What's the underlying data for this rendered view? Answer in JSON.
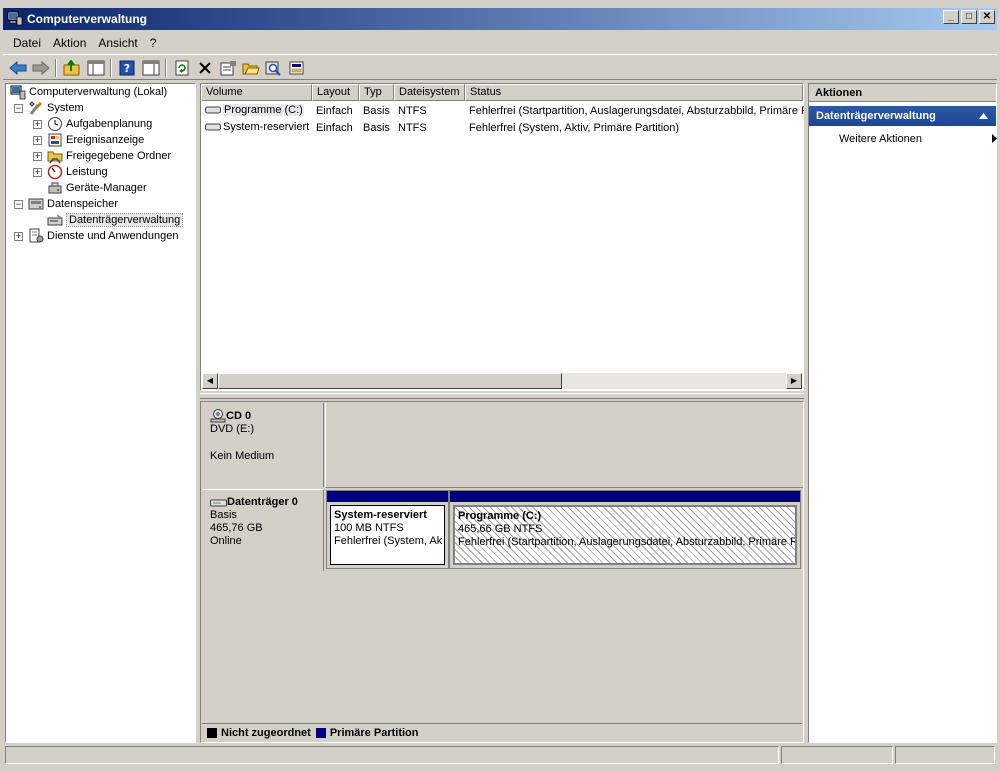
{
  "window": {
    "title": "Computerverwaltung"
  },
  "menu": [
    "Datei",
    "Aktion",
    "Ansicht",
    "?"
  ],
  "tree": {
    "root": "Computerverwaltung (Lokal)",
    "system": "System",
    "aufgabenplanung": "Aufgabenplanung",
    "ereignisanzeige": "Ereignisanzeige",
    "freigegebene_ordner": "Freigegebene Ordner",
    "leistung": "Leistung",
    "geraete_manager": "Geräte-Manager",
    "datenspeicher": "Datenspeicher",
    "datentraegerverwaltung": "Datenträgerverwaltung",
    "dienste": "Dienste und Anwendungen"
  },
  "volumes": {
    "headers": [
      "Volume",
      "Layout",
      "Typ",
      "Dateisystem",
      "Status"
    ],
    "rows": [
      {
        "volume": "Programme (C:)",
        "layout": "Einfach",
        "typ": "Basis",
        "fs": "NTFS",
        "status": "Fehlerfrei (Startpartition, Auslagerungsdatei, Absturzabbild, Primäre P"
      },
      {
        "volume": "System-reserviert",
        "layout": "Einfach",
        "typ": "Basis",
        "fs": "NTFS",
        "status": "Fehlerfrei (System, Aktiv, Primäre Partition)"
      }
    ]
  },
  "disks": {
    "cd": {
      "name": "CD 0",
      "type": "DVD (E:)",
      "media": "Kein Medium"
    },
    "disk0": {
      "name": "Datenträger 0",
      "kind": "Basis",
      "size": "465,76 GB",
      "state": "Online",
      "partitions": [
        {
          "name": "System-reserviert",
          "size": "100 MB NTFS",
          "status": "Fehlerfrei (System, Ak"
        },
        {
          "name": "Programme  (C:)",
          "size": "465,66 GB NTFS",
          "status": "Fehlerfrei (Startpartition, Auslagerungsdatei, Absturzabbild, Primäre P"
        }
      ]
    }
  },
  "legend": {
    "unallocated": "Nicht zugeordnet",
    "primary": "Primäre Partition",
    "unallocated_color": "#000000",
    "primary_color": "#000080"
  },
  "actions": {
    "title": "Aktionen",
    "section": "Datenträgerverwaltung",
    "more": "Weitere Aktionen"
  }
}
